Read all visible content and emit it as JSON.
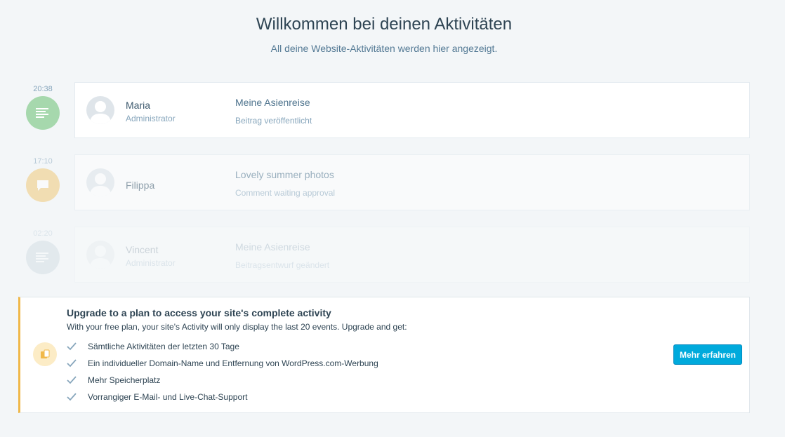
{
  "header": {
    "title": "Willkommen bei deinen Aktivitäten",
    "subtitle": "All deine Website-Aktivitäten werden hier angezeigt."
  },
  "events": [
    {
      "time": "20:38",
      "icon": "posts-icon",
      "icon_bg": "#a6d8ad",
      "actor_name": "Maria",
      "actor_role": "Administrator",
      "title": "Meine Asienreise",
      "description": "Beitrag veröffentlicht"
    },
    {
      "time": "17:10",
      "icon": "comment-icon",
      "icon_bg": "#f5dfa8",
      "actor_name": "Filippa",
      "actor_role": "",
      "title": "Lovely summer photos",
      "description": "Comment waiting approval"
    },
    {
      "time": "02:20",
      "icon": "posts-icon",
      "icon_bg": "#c8d7e1",
      "actor_name": "Vincent",
      "actor_role": "Administrator",
      "title": "Meine Asienreise",
      "description": "Beitragsentwurf geändert"
    }
  ],
  "upgrade": {
    "title": "Upgrade to a plan to access your site's complete activity",
    "text": "With your free plan, your site's Activity will only display the last 20 events. Upgrade and get:",
    "features": [
      "Sämtliche Aktivitäten der letzten 30 Tage",
      "Ein individueller Domain-Name und Entfernung von WordPress.com-Werbung",
      "Mehr Speicherplatz",
      "Vorrangiger E-Mail- und Live-Chat-Support"
    ],
    "button_label": "Mehr erfahren",
    "accent": "#f0b849",
    "button_color": "#00aadc"
  }
}
